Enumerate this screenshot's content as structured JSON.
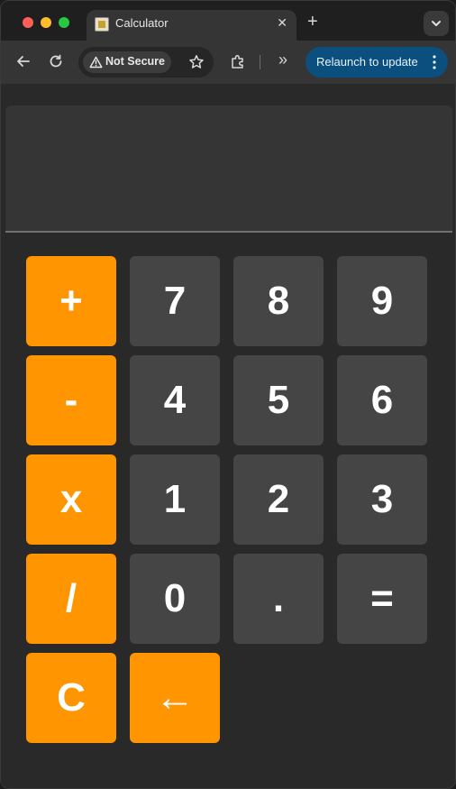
{
  "browser": {
    "tab_title": "Calculator",
    "tab_close": "✕",
    "new_tab": "+",
    "security_chip": "Not Secure",
    "relaunch": "Relaunch to update",
    "extensions_overflow": "»",
    "icons": [
      "back-icon",
      "reload-icon",
      "warning-icon",
      "star-icon",
      "extensions-icon",
      "chevron-down-icon",
      "more-vert-icon"
    ]
  },
  "calculator": {
    "display": "",
    "keys": {
      "plus": "+",
      "seven": "7",
      "eight": "8",
      "nine": "9",
      "minus": "-",
      "four": "4",
      "five": "5",
      "six": "6",
      "multiply": "x",
      "one": "1",
      "two": "2",
      "three": "3",
      "divide": "/",
      "zero": "0",
      "decimal": ".",
      "equals": "=",
      "clear": "C",
      "backspace": "←"
    },
    "colors": {
      "operator": "#ff9500",
      "number": "#454545",
      "display": "#353535",
      "background": "#292929"
    }
  }
}
